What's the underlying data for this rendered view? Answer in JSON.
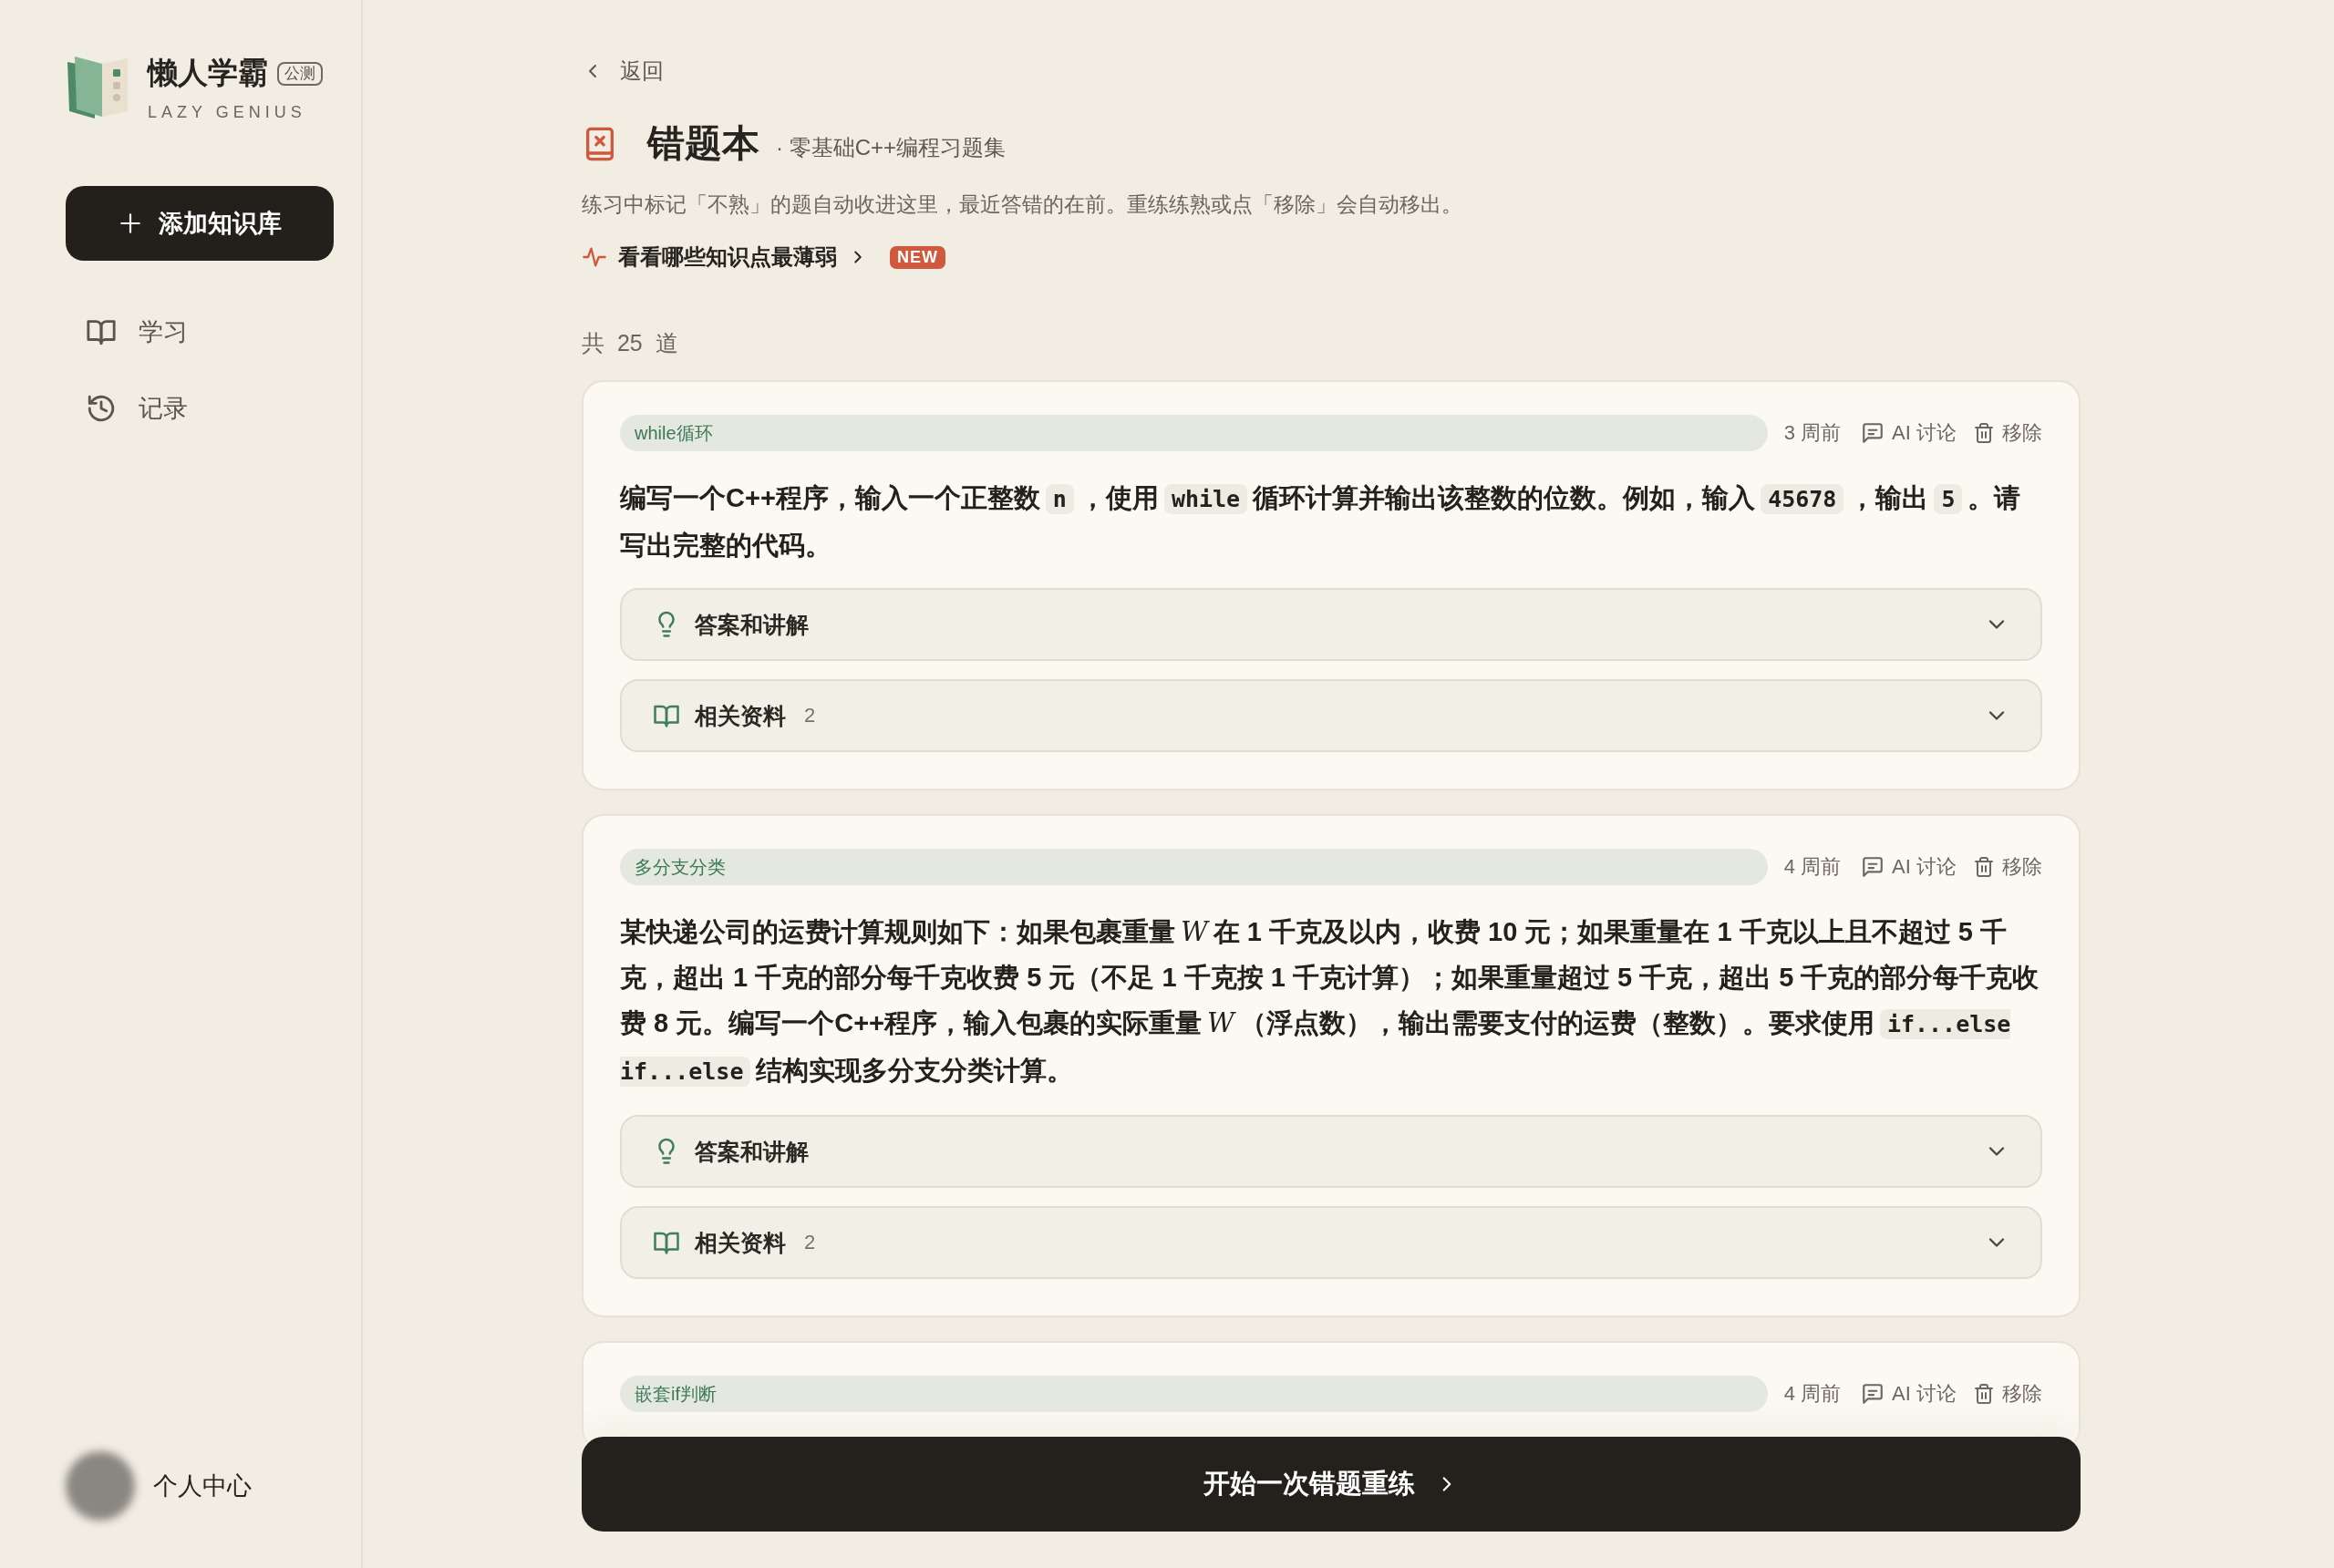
{
  "sidebar": {
    "logo_title": "懒人学霸",
    "badge": "公测",
    "logo_subtitle": "LAZY GENIUS",
    "add_button": "添加知识库",
    "nav": [
      {
        "label": "学习",
        "kind": "study",
        "selected": false
      },
      {
        "label": "记录",
        "kind": "records",
        "selected": false
      }
    ],
    "profile": "个人中心"
  },
  "header": {
    "back": "返回",
    "title": "错题本",
    "subtitle": "· 零基础C++编程习题集",
    "description": "练习中标记「不熟」的题自动收进这里，最近答错的在前。重练练熟或点「移除」会自动移出。",
    "weak_link": "看看哪些知识点最薄弱",
    "new_badge": "NEW",
    "count": "共  25  道"
  },
  "cards": [
    {
      "tag": "while循环",
      "time": "3 周前",
      "discuss": "AI 讨论",
      "remove": "移除",
      "question": [
        {
          "kind": "text",
          "text": "编写一个C++程序，输入一个正整数"
        },
        {
          "kind": "code",
          "text": "n"
        },
        {
          "kind": "text",
          "text": "，使用"
        },
        {
          "kind": "code",
          "text": "while"
        },
        {
          "kind": "text",
          "text": "循环计算并输出该整数的位数。例如，输入"
        },
        {
          "kind": "code",
          "text": "45678"
        },
        {
          "kind": "text",
          "text": "，输出"
        },
        {
          "kind": "code",
          "text": "5"
        },
        {
          "kind": "text",
          "text": "。请写出完整的代码。"
        }
      ],
      "sections": [
        {
          "kind": "answer",
          "label": "答案和讲解",
          "expanded": false
        },
        {
          "kind": "resources",
          "label": "相关资料",
          "count": "2",
          "expanded": false
        }
      ]
    },
    {
      "tag": "多分支分类",
      "time": "4 周前",
      "discuss": "AI 讨论",
      "remove": "移除",
      "question": [
        {
          "kind": "text",
          "text": "某快递公司的运费计算规则如下：如果包裹重量"
        },
        {
          "kind": "math",
          "text": "W"
        },
        {
          "kind": "text",
          "text": "在 1 千克及以内，收费 10 元；如果重量在 1 千克以上且不超过 5 千克，超出 1 千克的部分每千克收费 5 元（不足 1 千克按 1 千克计算）；如果重量超过 5 千克，超出 5 千克的部分每千克收费 8 元。编写一个C++程序，输入包裹的实际重量"
        },
        {
          "kind": "math",
          "text": "W"
        },
        {
          "kind": "text",
          "text": "（浮点数），输出需要支付的运费（整数）。要求使用"
        },
        {
          "kind": "code",
          "text": "if...else if...else"
        },
        {
          "kind": "text",
          "text": "结构实现多分支分类计算。"
        }
      ],
      "sections": [
        {
          "kind": "answer",
          "label": "答案和讲解",
          "expanded": false
        },
        {
          "kind": "resources",
          "label": "相关资料",
          "count": "2",
          "expanded": false
        }
      ]
    },
    {
      "tag": "嵌套if判断",
      "time": "4 周前",
      "discuss": "AI 讨论",
      "remove": "移除"
    }
  ],
  "start_button": "开始一次错题重练"
}
